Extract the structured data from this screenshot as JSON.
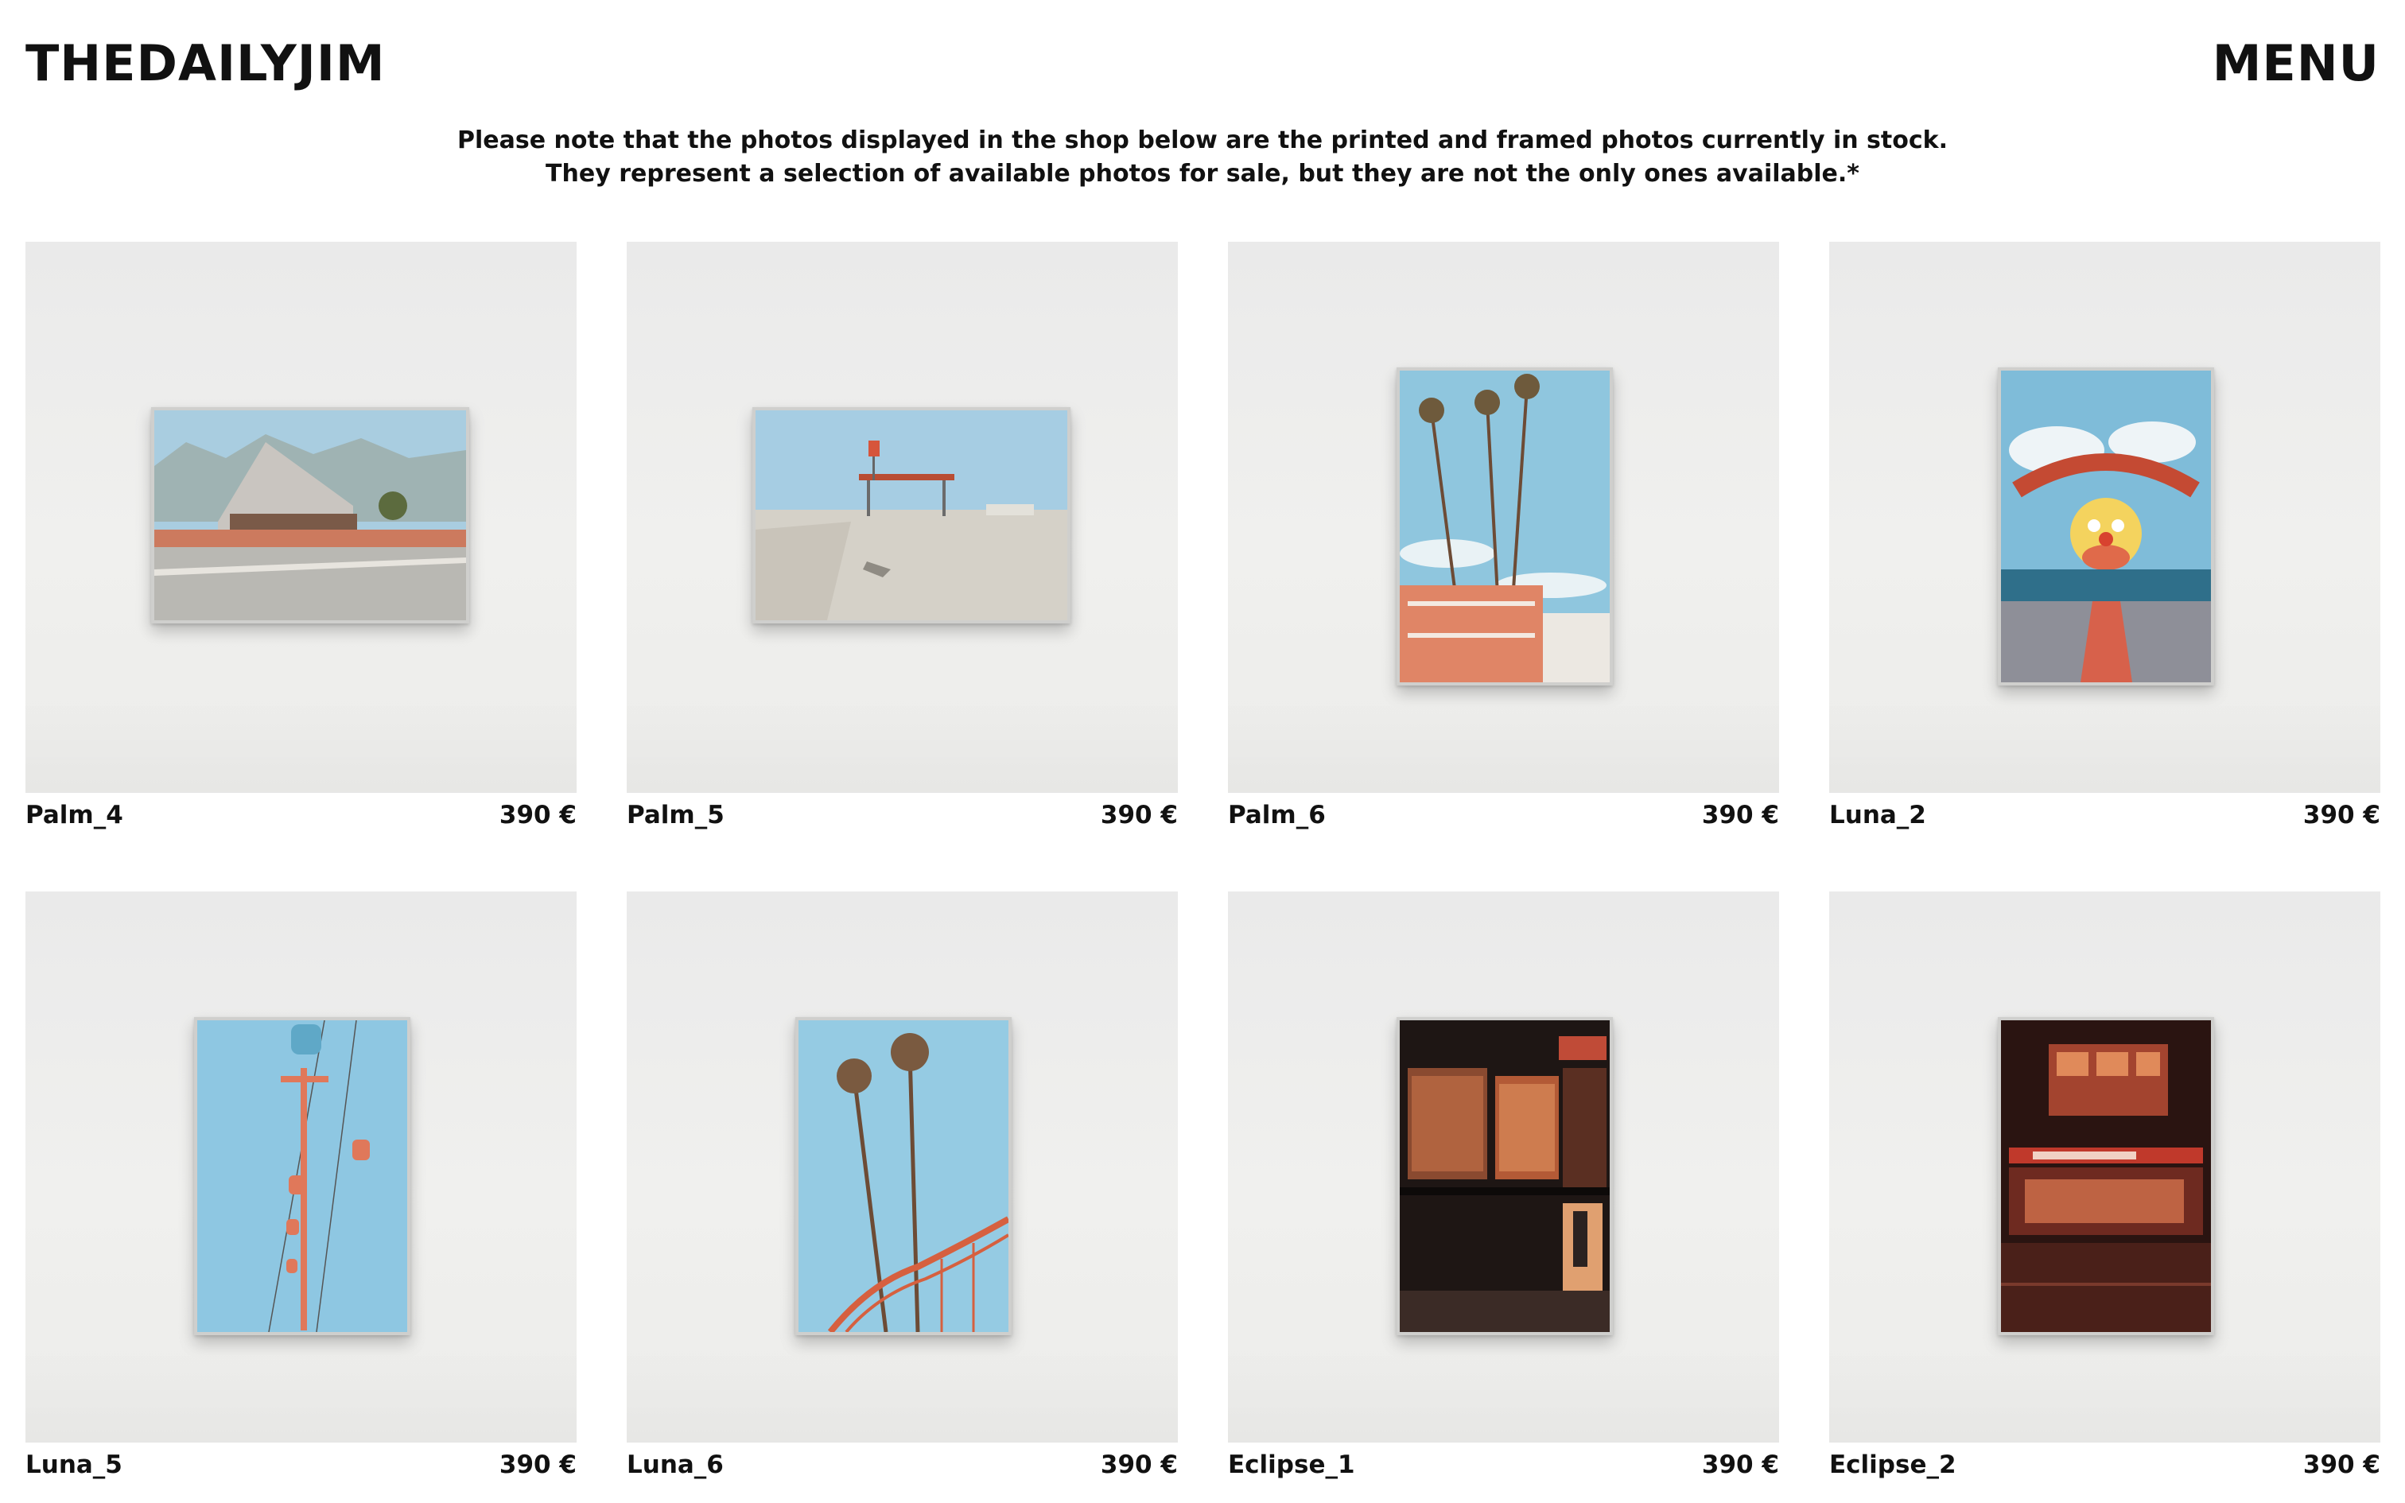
{
  "header": {
    "logo": "THEDAILYJIM",
    "menu_label": "MENU"
  },
  "notice": {
    "line1": "Please note that the photos displayed in the shop below are the printed and framed photos currently in stock.",
    "line2": "They represent a selection of available photos for sale, but they are not the only ones available.*"
  },
  "products": [
    {
      "name": "Palm_4",
      "price": "390 €"
    },
    {
      "name": "Palm_5",
      "price": "390 €"
    },
    {
      "name": "Palm_6",
      "price": "390 €"
    },
    {
      "name": "Luna_2",
      "price": "390 €"
    },
    {
      "name": "Luna_5",
      "price": "390 €"
    },
    {
      "name": "Luna_6",
      "price": "390 €"
    },
    {
      "name": "Eclipse_1",
      "price": "390 €"
    },
    {
      "name": "Eclipse_2",
      "price": "390 €"
    }
  ]
}
